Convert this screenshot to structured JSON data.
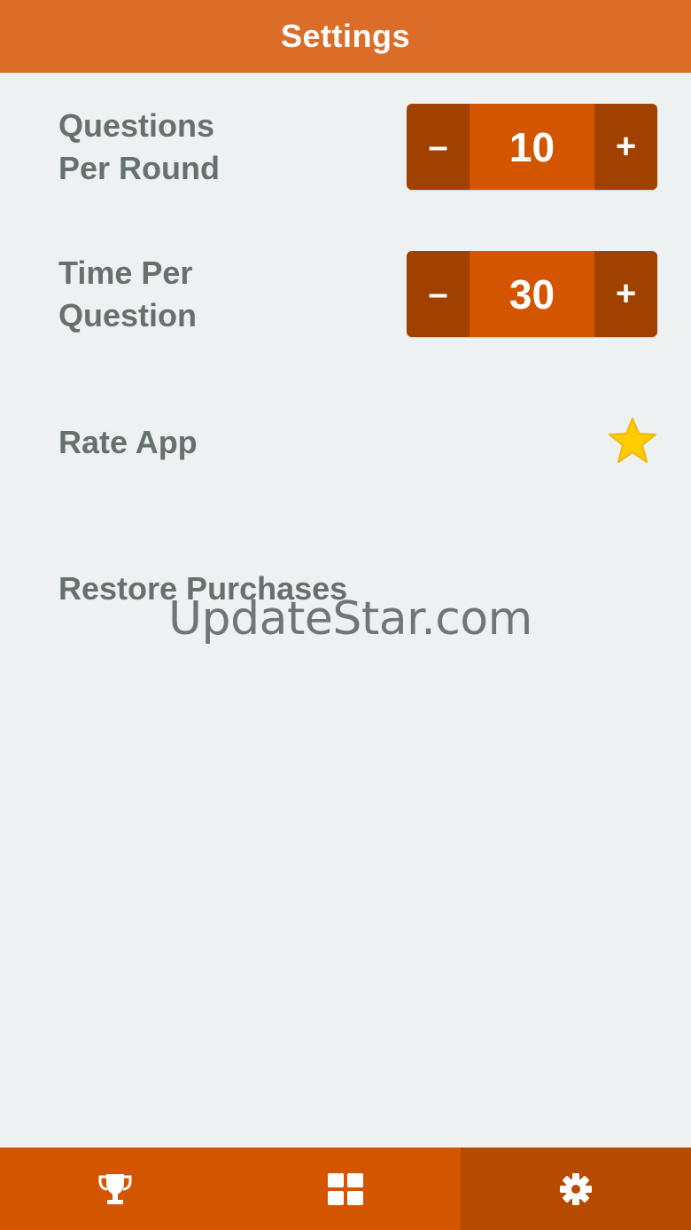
{
  "header": {
    "title": "Settings"
  },
  "settings": {
    "questions_per_round": {
      "label_line1": "Questions",
      "label_line2": "Per Round",
      "decrement_label": "–",
      "value": "10",
      "increment_label": "+"
    },
    "time_per_question": {
      "label_line1": "Time Per",
      "label_line2": "Question",
      "decrement_label": "–",
      "value": "30",
      "increment_label": "+"
    },
    "rate_app": {
      "label": "Rate App",
      "icon": "star-icon"
    },
    "restore_purchases": {
      "label": "Restore Purchases"
    }
  },
  "watermark": {
    "text": "UpdateStar.com"
  },
  "tabbar": {
    "tabs": [
      {
        "icon": "trophy-icon",
        "active": false
      },
      {
        "icon": "grid-icon",
        "active": false
      },
      {
        "icon": "gear-icon",
        "active": true
      }
    ]
  },
  "colors": {
    "header": "#db6d29",
    "background": "#edf1f2",
    "stepper_button": "#a04100",
    "stepper_value": "#d45500",
    "label_text": "#66706d",
    "star": "#ffcc00",
    "tabbar": "#d45500",
    "tabbar_active": "#b54a00"
  }
}
